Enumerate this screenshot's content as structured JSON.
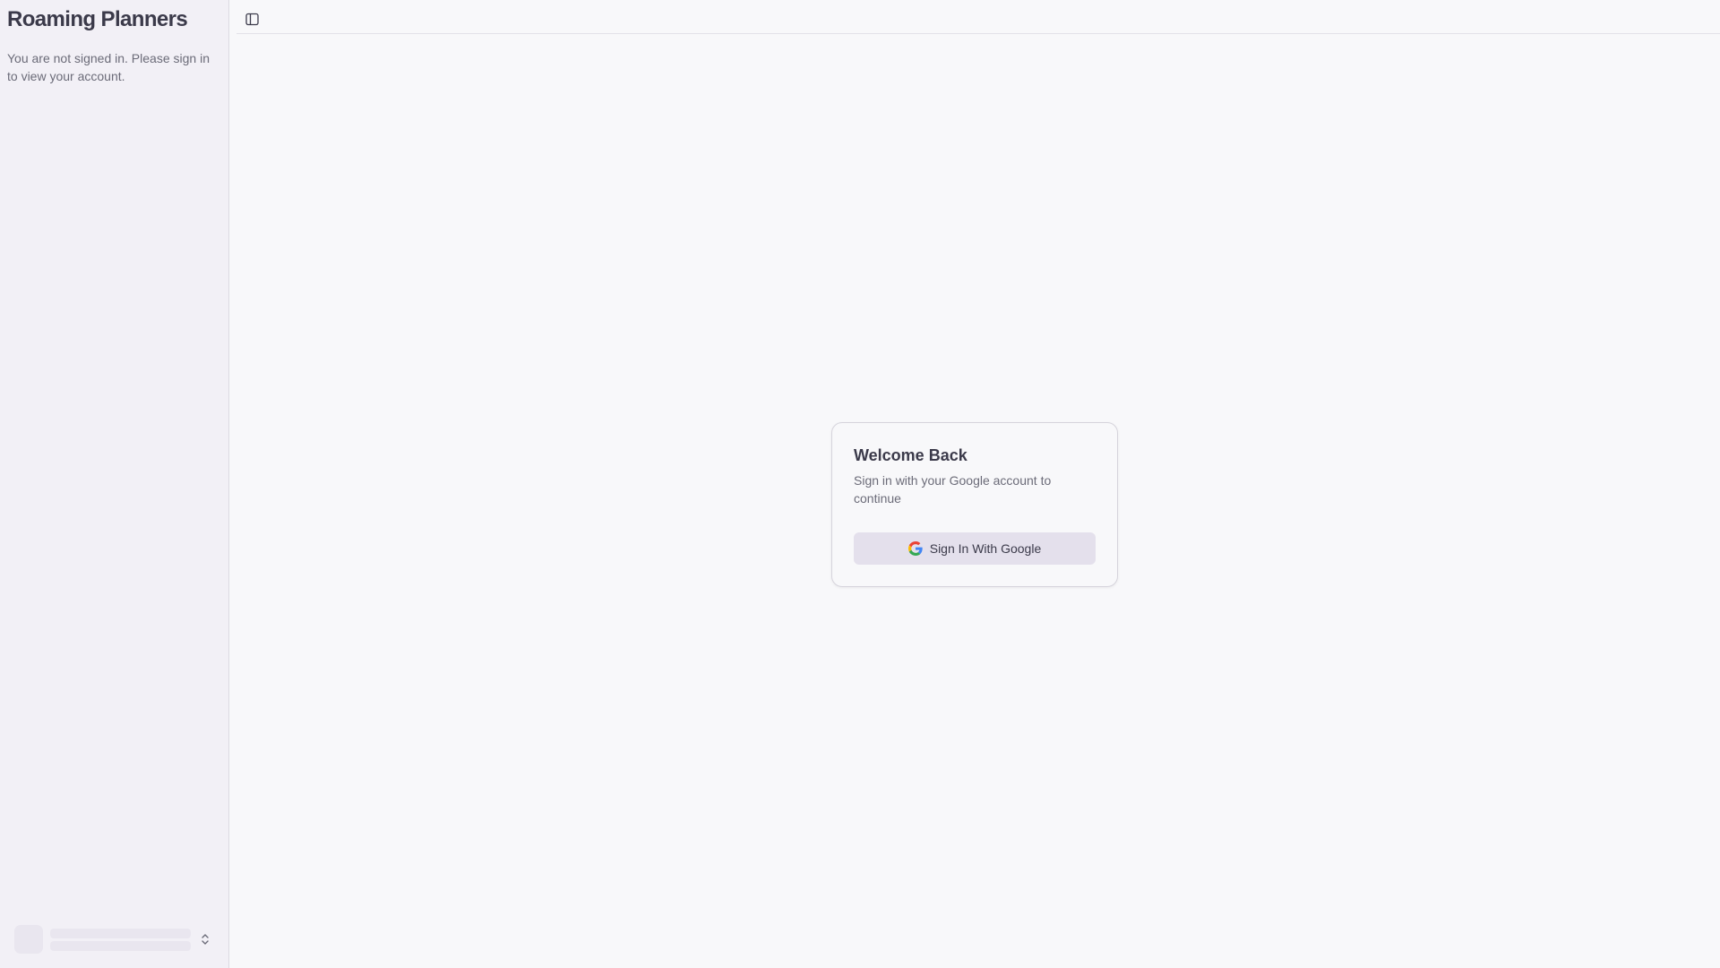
{
  "sidebar": {
    "title": "Roaming Planners",
    "message": "You are not signed in. Please sign in to view your account.",
    "footer": {
      "avatar_icon": "avatar-placeholder",
      "chevron_icon": "chevrons-up-down-icon"
    }
  },
  "topbar": {
    "toggle_icon": "sidebar-toggle-icon"
  },
  "login_card": {
    "title": "Welcome Back",
    "description": "Sign in with your Google account to continue",
    "button_label": "Sign In With Google",
    "button_icon": "google-icon"
  },
  "colors": {
    "sidebar_bg": "#f2f0f6",
    "page_bg": "#f8f8fa",
    "button_bg": "#e4e0ec",
    "google_blue": "#4285F4",
    "google_red": "#EA4335",
    "google_yellow": "#FBBC05",
    "google_green": "#34A853"
  }
}
